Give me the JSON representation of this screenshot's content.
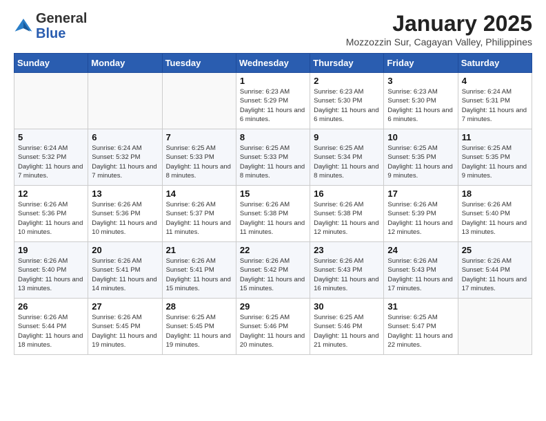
{
  "header": {
    "logo_general": "General",
    "logo_blue": "Blue",
    "month_title": "January 2025",
    "subtitle": "Mozzozzin Sur, Cagayan Valley, Philippines"
  },
  "days_of_week": [
    "Sunday",
    "Monday",
    "Tuesday",
    "Wednesday",
    "Thursday",
    "Friday",
    "Saturday"
  ],
  "weeks": [
    [
      {
        "day": "",
        "info": ""
      },
      {
        "day": "",
        "info": ""
      },
      {
        "day": "",
        "info": ""
      },
      {
        "day": "1",
        "info": "Sunrise: 6:23 AM\nSunset: 5:29 PM\nDaylight: 11 hours and 6 minutes."
      },
      {
        "day": "2",
        "info": "Sunrise: 6:23 AM\nSunset: 5:30 PM\nDaylight: 11 hours and 6 minutes."
      },
      {
        "day": "3",
        "info": "Sunrise: 6:23 AM\nSunset: 5:30 PM\nDaylight: 11 hours and 6 minutes."
      },
      {
        "day": "4",
        "info": "Sunrise: 6:24 AM\nSunset: 5:31 PM\nDaylight: 11 hours and 7 minutes."
      }
    ],
    [
      {
        "day": "5",
        "info": "Sunrise: 6:24 AM\nSunset: 5:32 PM\nDaylight: 11 hours and 7 minutes."
      },
      {
        "day": "6",
        "info": "Sunrise: 6:24 AM\nSunset: 5:32 PM\nDaylight: 11 hours and 7 minutes."
      },
      {
        "day": "7",
        "info": "Sunrise: 6:25 AM\nSunset: 5:33 PM\nDaylight: 11 hours and 8 minutes."
      },
      {
        "day": "8",
        "info": "Sunrise: 6:25 AM\nSunset: 5:33 PM\nDaylight: 11 hours and 8 minutes."
      },
      {
        "day": "9",
        "info": "Sunrise: 6:25 AM\nSunset: 5:34 PM\nDaylight: 11 hours and 8 minutes."
      },
      {
        "day": "10",
        "info": "Sunrise: 6:25 AM\nSunset: 5:35 PM\nDaylight: 11 hours and 9 minutes."
      },
      {
        "day": "11",
        "info": "Sunrise: 6:25 AM\nSunset: 5:35 PM\nDaylight: 11 hours and 9 minutes."
      }
    ],
    [
      {
        "day": "12",
        "info": "Sunrise: 6:26 AM\nSunset: 5:36 PM\nDaylight: 11 hours and 10 minutes."
      },
      {
        "day": "13",
        "info": "Sunrise: 6:26 AM\nSunset: 5:36 PM\nDaylight: 11 hours and 10 minutes."
      },
      {
        "day": "14",
        "info": "Sunrise: 6:26 AM\nSunset: 5:37 PM\nDaylight: 11 hours and 11 minutes."
      },
      {
        "day": "15",
        "info": "Sunrise: 6:26 AM\nSunset: 5:38 PM\nDaylight: 11 hours and 11 minutes."
      },
      {
        "day": "16",
        "info": "Sunrise: 6:26 AM\nSunset: 5:38 PM\nDaylight: 11 hours and 12 minutes."
      },
      {
        "day": "17",
        "info": "Sunrise: 6:26 AM\nSunset: 5:39 PM\nDaylight: 11 hours and 12 minutes."
      },
      {
        "day": "18",
        "info": "Sunrise: 6:26 AM\nSunset: 5:40 PM\nDaylight: 11 hours and 13 minutes."
      }
    ],
    [
      {
        "day": "19",
        "info": "Sunrise: 6:26 AM\nSunset: 5:40 PM\nDaylight: 11 hours and 13 minutes."
      },
      {
        "day": "20",
        "info": "Sunrise: 6:26 AM\nSunset: 5:41 PM\nDaylight: 11 hours and 14 minutes."
      },
      {
        "day": "21",
        "info": "Sunrise: 6:26 AM\nSunset: 5:41 PM\nDaylight: 11 hours and 15 minutes."
      },
      {
        "day": "22",
        "info": "Sunrise: 6:26 AM\nSunset: 5:42 PM\nDaylight: 11 hours and 15 minutes."
      },
      {
        "day": "23",
        "info": "Sunrise: 6:26 AM\nSunset: 5:43 PM\nDaylight: 11 hours and 16 minutes."
      },
      {
        "day": "24",
        "info": "Sunrise: 6:26 AM\nSunset: 5:43 PM\nDaylight: 11 hours and 17 minutes."
      },
      {
        "day": "25",
        "info": "Sunrise: 6:26 AM\nSunset: 5:44 PM\nDaylight: 11 hours and 17 minutes."
      }
    ],
    [
      {
        "day": "26",
        "info": "Sunrise: 6:26 AM\nSunset: 5:44 PM\nDaylight: 11 hours and 18 minutes."
      },
      {
        "day": "27",
        "info": "Sunrise: 6:26 AM\nSunset: 5:45 PM\nDaylight: 11 hours and 19 minutes."
      },
      {
        "day": "28",
        "info": "Sunrise: 6:25 AM\nSunset: 5:45 PM\nDaylight: 11 hours and 19 minutes."
      },
      {
        "day": "29",
        "info": "Sunrise: 6:25 AM\nSunset: 5:46 PM\nDaylight: 11 hours and 20 minutes."
      },
      {
        "day": "30",
        "info": "Sunrise: 6:25 AM\nSunset: 5:46 PM\nDaylight: 11 hours and 21 minutes."
      },
      {
        "day": "31",
        "info": "Sunrise: 6:25 AM\nSunset: 5:47 PM\nDaylight: 11 hours and 22 minutes."
      },
      {
        "day": "",
        "info": ""
      }
    ]
  ]
}
